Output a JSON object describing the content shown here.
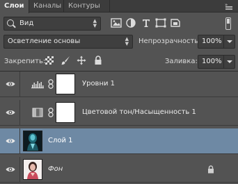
{
  "tabs": [
    {
      "label": "Слои",
      "active": true
    },
    {
      "label": "Каналы",
      "active": false
    },
    {
      "label": "Контуры",
      "active": false
    }
  ],
  "filter": {
    "kind_label": "Вид",
    "icons": [
      "image-filter-icon",
      "adjustment-filter-icon",
      "text-filter-icon",
      "shape-filter-icon",
      "smart-object-filter-icon"
    ]
  },
  "blend": {
    "mode": "Осветление основы",
    "opacity_label": "Непрозрачность:",
    "opacity_value": "100%"
  },
  "lock": {
    "label": "Закрепить:",
    "icons": [
      "lock-transparent-icon",
      "lock-image-icon",
      "lock-position-icon",
      "lock-all-icon"
    ],
    "fill_label": "Заливка:",
    "fill_value": "100%"
  },
  "layers": [
    {
      "name": "Уровни 1",
      "type": "adjustment",
      "adjustment_icon": "levels-icon",
      "selected": false,
      "locked": false
    },
    {
      "name": "Цветовой тон/Насыщенность 1",
      "type": "adjustment",
      "adjustment_icon": "hue-saturation-icon",
      "selected": false,
      "locked": false
    },
    {
      "name": "Слой 1",
      "type": "pixel",
      "selected": true,
      "locked": false
    },
    {
      "name": "Фон",
      "type": "background",
      "selected": false,
      "locked": true
    }
  ],
  "colors": {
    "panel": "#535353",
    "selection": "#6e89a4",
    "tabbar": "#3c3c3c"
  }
}
